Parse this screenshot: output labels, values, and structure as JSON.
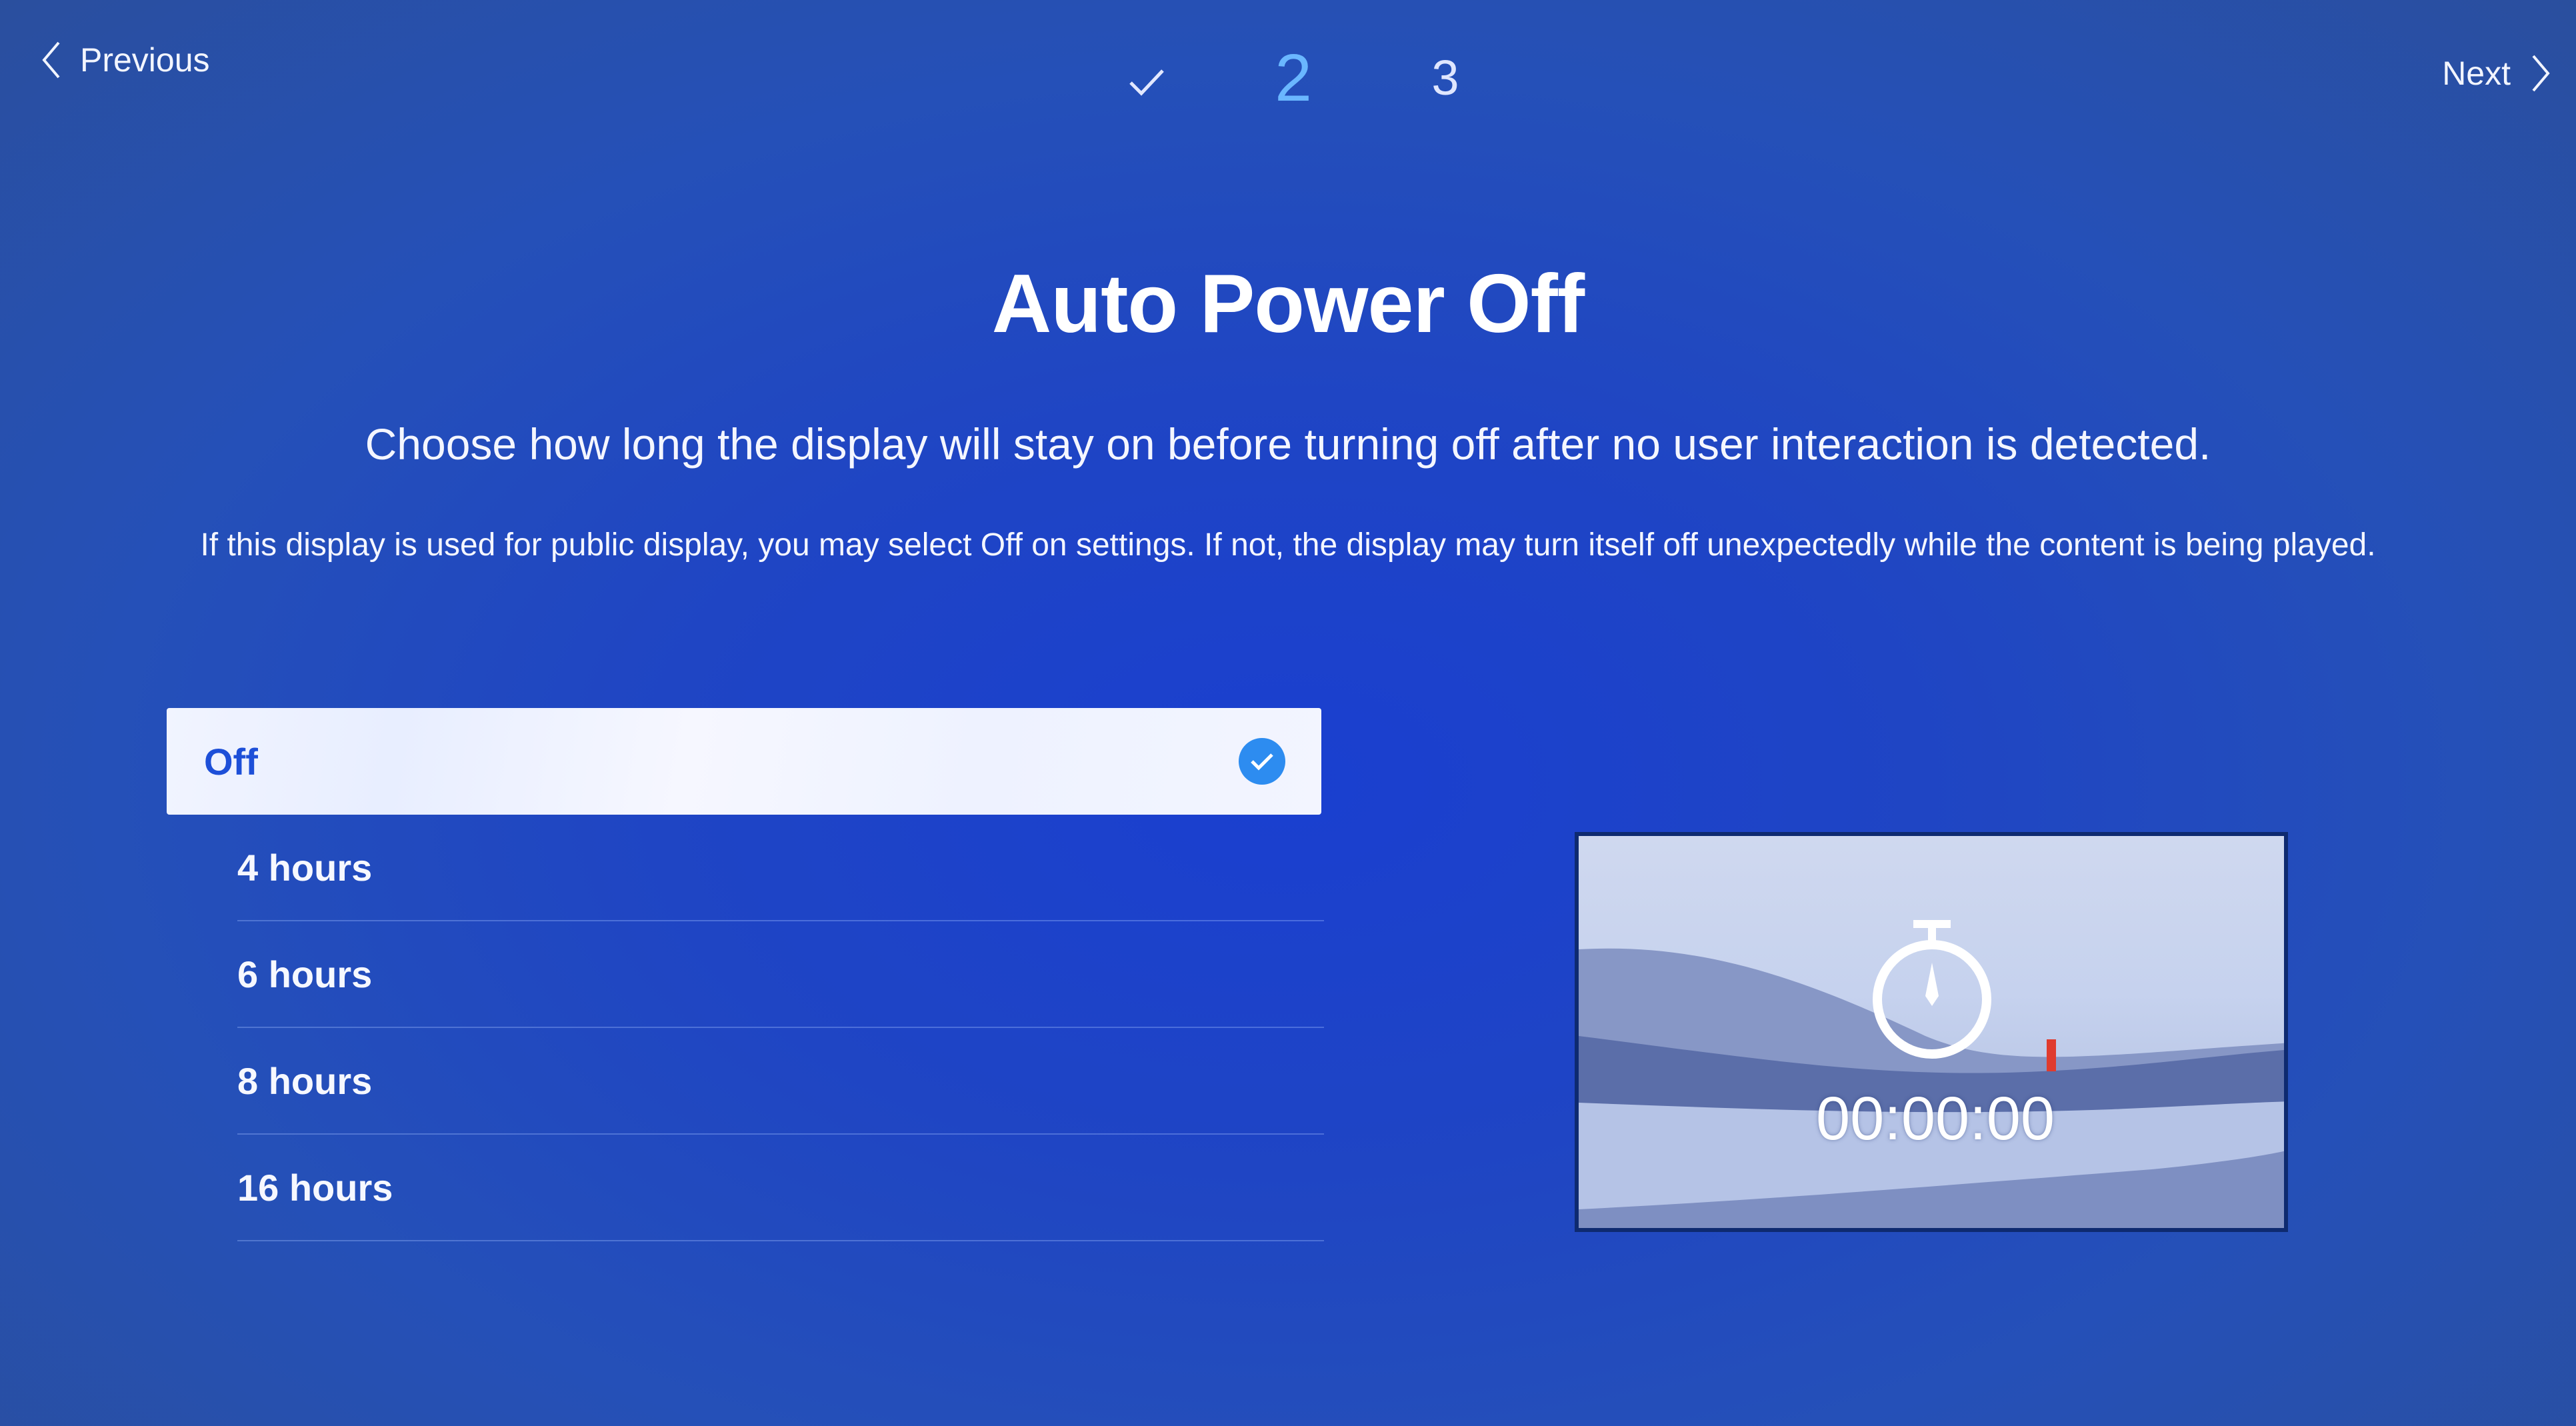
{
  "header": {
    "previous_label": "Previous",
    "next_label": "Next",
    "steps": [
      {
        "label": "✓",
        "state": "completed"
      },
      {
        "label": "2",
        "state": "current"
      },
      {
        "label": "3",
        "state": "upcoming"
      }
    ]
  },
  "main": {
    "title": "Auto Power Off",
    "subtitle": "Choose how long the display will stay on before turning off after no user interaction is detected.",
    "note": "If this display is used for public display, you may select Off on settings. If not, the display may turn itself off unexpectedly while the content is being played."
  },
  "options": {
    "selected_index": 0,
    "items": [
      {
        "label": "Off"
      },
      {
        "label": "4 hours"
      },
      {
        "label": "6 hours"
      },
      {
        "label": "8 hours"
      },
      {
        "label": "16 hours"
      }
    ]
  },
  "preview": {
    "timer_text": "00:00:00",
    "icon": "stopwatch-icon"
  },
  "colors": {
    "background": "#1f45c4",
    "accent": "#2d8cf0",
    "current_step": "#6ab7ff",
    "selected_text": "#1d4fd8"
  }
}
